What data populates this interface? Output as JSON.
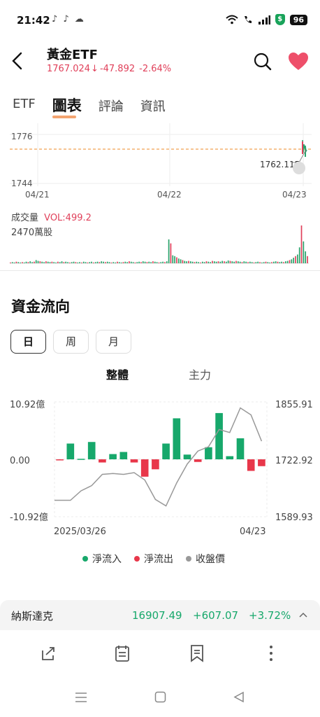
{
  "status_bar": {
    "time": "21:42",
    "left_icons": "♪ ♪ ☁",
    "battery": "96",
    "shield": "$"
  },
  "header": {
    "title": "黃金ETF",
    "price": "1767.024",
    "arrow": "↓",
    "change": "-47.892",
    "change_pct": "-2.64%"
  },
  "tabs": [
    {
      "label": "ETF",
      "active": false
    },
    {
      "label": "圖表",
      "active": true
    },
    {
      "label": "評論",
      "active": false
    },
    {
      "label": "資訊",
      "active": false
    }
  ],
  "price_chart": {
    "y_high": "1776",
    "y_low": "1744",
    "x_labels": [
      "04/21",
      "04/22",
      "04/23"
    ],
    "last_price_label": "1762.115",
    "line_color": "#2aa36b",
    "ref_line_color": "#f0a050"
  },
  "volume": {
    "label": "成交量",
    "vol_text": "VOL:499.2",
    "max_label": "2470萬股",
    "bars": [
      2,
      3,
      2,
      4,
      3,
      2,
      3,
      2,
      4,
      3,
      5,
      3,
      4,
      8,
      6,
      5,
      4,
      3,
      5,
      4,
      3,
      4,
      3,
      2,
      4,
      3,
      5,
      3,
      4,
      3,
      2,
      3,
      4,
      3,
      2,
      3,
      2,
      4,
      3,
      2,
      3,
      4,
      2,
      3,
      4,
      3,
      5,
      4,
      3,
      4,
      3,
      2,
      3,
      2,
      4,
      3,
      2,
      3,
      4,
      3,
      5,
      4,
      3,
      2,
      3,
      4,
      3,
      5,
      4,
      3,
      4,
      3,
      5,
      4,
      3,
      2,
      3,
      4,
      3,
      5,
      60,
      50,
      20,
      18,
      15,
      12,
      10,
      8,
      6,
      5,
      6,
      5,
      4,
      3,
      4,
      3,
      2,
      4,
      3,
      5,
      4,
      3,
      6,
      5,
      4,
      5,
      4,
      6,
      5,
      4,
      7,
      6,
      5,
      4,
      6,
      5,
      4,
      3,
      5,
      4,
      3,
      4,
      3,
      2,
      3,
      4,
      3,
      2,
      3,
      4,
      3,
      2,
      3,
      4,
      5,
      4,
      3,
      4,
      3,
      5,
      6,
      8,
      10,
      14,
      18,
      22,
      40,
      95,
      55,
      30,
      18
    ]
  },
  "fund_flow": {
    "title": "資金流向",
    "periods": [
      {
        "label": "日",
        "selected": true
      },
      {
        "label": "周",
        "selected": false
      },
      {
        "label": "月",
        "selected": false
      }
    ],
    "subtabs": [
      "整體",
      "主力"
    ],
    "y_left": [
      "10.92億",
      "0.00",
      "-10.92億"
    ],
    "y_right": [
      "1855.91",
      "1722.92",
      "1589.93"
    ],
    "x_labels": [
      "2025/03/26",
      "04/23"
    ],
    "legend": [
      {
        "label": "淨流入",
        "color": "#17a86b"
      },
      {
        "label": "淨流出",
        "color": "#e8374a"
      },
      {
        "label": "收盤價",
        "color": "#999999"
      }
    ]
  },
  "chart_data": {
    "type": "bar",
    "title": "",
    "xlabel": "",
    "ylabel": "",
    "ylim": [
      -10.92,
      10.92
    ],
    "y2lim": [
      1589.93,
      1855.91
    ],
    "x": [
      "2025/03/26",
      "",
      "",
      "",
      "",
      "",
      "",
      "",
      "",
      "",
      "",
      "",
      "",
      "",
      "",
      "",
      "",
      "",
      "",
      "04/23"
    ],
    "series": [
      {
        "name": "淨流入/淨流出",
        "values": [
          -0.1,
          3.0,
          0.1,
          3.3,
          -0.6,
          1.0,
          1.4,
          -0.6,
          -3.3,
          -1.9,
          3.0,
          7.8,
          0.9,
          -0.5,
          2.3,
          8.8,
          0.6,
          4.0,
          -2.2,
          -1.3
        ]
      },
      {
        "name": "收盤價",
        "values": [
          1628,
          1628,
          1650,
          1662,
          1688,
          1690,
          1688,
          1692,
          1675,
          1630,
          1615,
          1668,
          1712,
          1742,
          1752,
          1792,
          1785,
          1842,
          1826,
          1765
        ]
      }
    ]
  },
  "ticker": {
    "name": "納斯達克",
    "value": "16907.49",
    "change": "+607.07",
    "pct": "+3.72%",
    "chevron": "^"
  },
  "bottom_icons": [
    "share-icon",
    "calendar-icon",
    "bookmark-icon",
    "more-icon"
  ],
  "nav_icons": [
    "menu-icon",
    "home-icon",
    "back-icon"
  ]
}
